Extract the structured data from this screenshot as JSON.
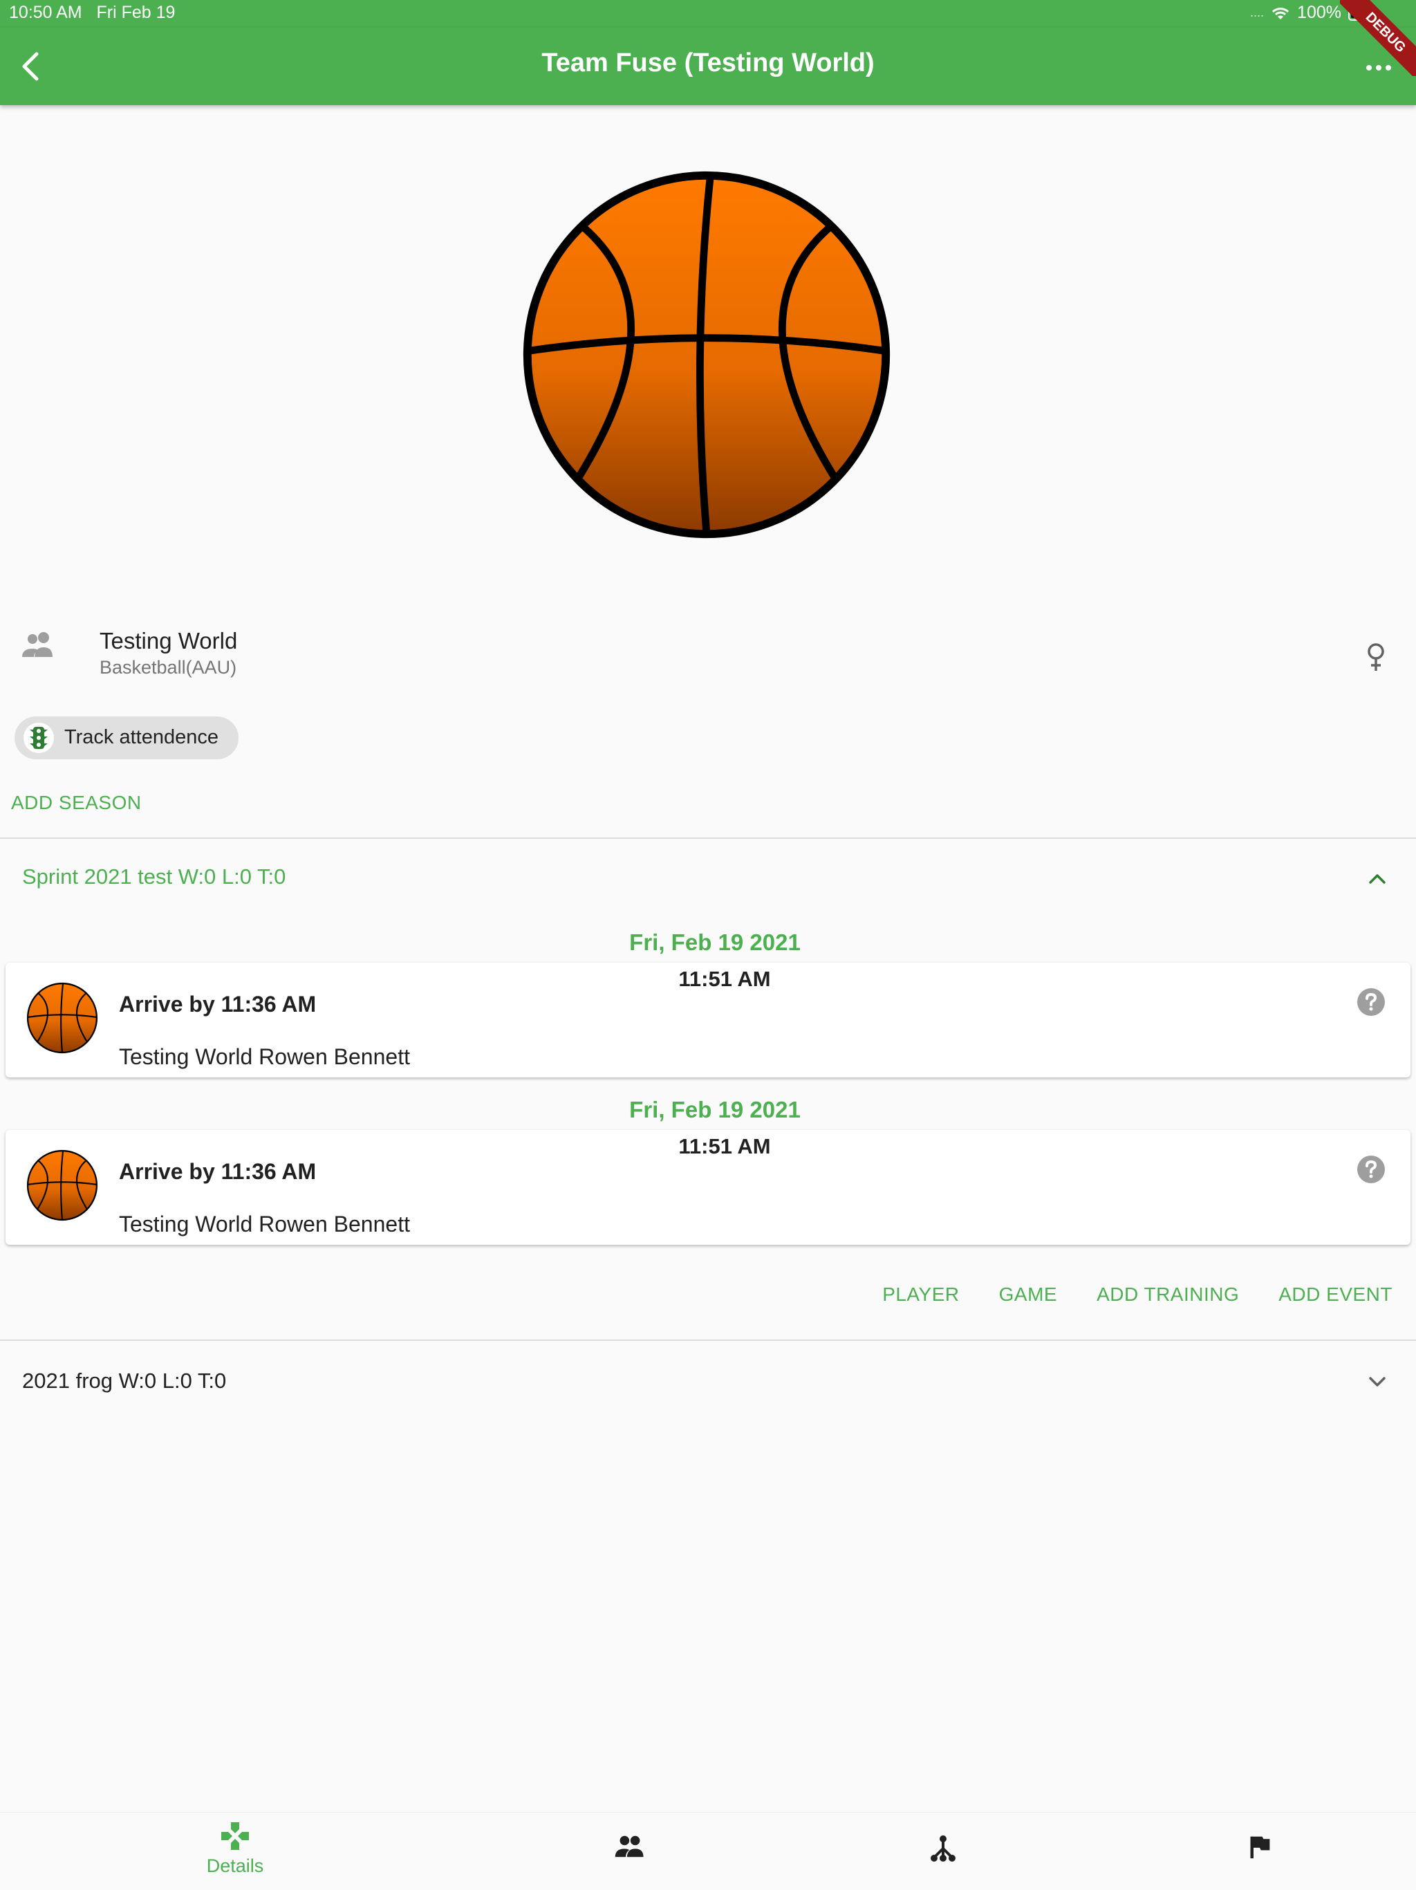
{
  "status_bar": {
    "time": "10:50 AM",
    "date": "Fri Feb 19",
    "battery": "100%",
    "signal": "....",
    "debug_label": "DEBUG"
  },
  "app_bar": {
    "title": "Team Fuse (Testing World)",
    "back_icon": "chevron-left-icon",
    "more_icon": "more-horiz-icon",
    "color": "#4caf50"
  },
  "team": {
    "name": "Testing World",
    "sport": "Basketball(AAU)",
    "icon": "people-icon",
    "gender_icon": "female-icon"
  },
  "attendance_chip": {
    "label": "Track attendence",
    "icon": "traffic-light-icon"
  },
  "add_season_label": "ADD SEASON",
  "seasons": [
    {
      "header": "Sprint 2021 test W:0 L:0 T:0",
      "expanded": true,
      "events": [
        {
          "date": "Fri, Feb 19 2021",
          "time": "11:51 AM",
          "arrive": "Arrive by 11:36 AM",
          "details": "Testing World Rowen Bennett",
          "status_icon": "help-icon"
        },
        {
          "date": "Fri, Feb 19 2021",
          "time": "11:51 AM",
          "arrive": "Arrive by 11:36 AM",
          "details": "Testing World Rowen Bennett",
          "status_icon": "help-icon"
        }
      ],
      "actions": [
        "PLAYER",
        "GAME",
        "ADD TRAINING",
        "ADD EVENT"
      ]
    },
    {
      "header": "2021 frog W:0 L:0 T:0",
      "expanded": false
    }
  ],
  "bottom_nav": [
    {
      "label": "Details",
      "icon": "gamepad-icon",
      "active": true
    },
    {
      "label": "",
      "icon": "people-icon",
      "active": false
    },
    {
      "label": "",
      "icon": "network-icon",
      "active": false
    },
    {
      "label": "",
      "icon": "flag-icon",
      "active": false
    }
  ]
}
